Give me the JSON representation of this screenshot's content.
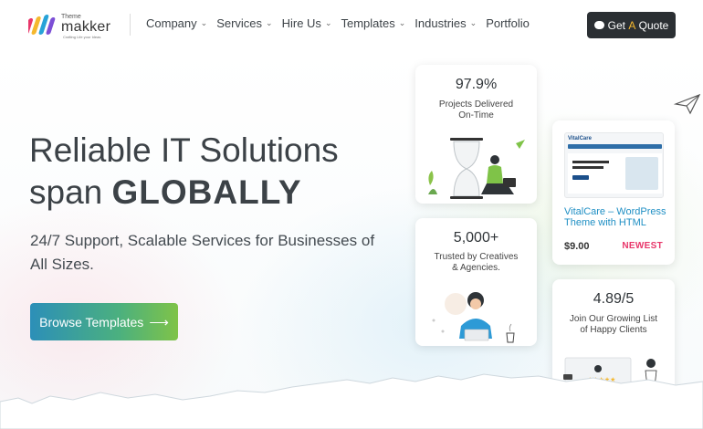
{
  "nav": {
    "logo_small": "Theme",
    "logo_brand": "makker",
    "logo_tagline": "Crafting Life your Ideas",
    "menu": [
      {
        "label": "Company",
        "dropdown": true
      },
      {
        "label": "Services",
        "dropdown": true
      },
      {
        "label": "Hire Us",
        "dropdown": true
      },
      {
        "label": "Templates",
        "dropdown": true
      },
      {
        "label": "Industries",
        "dropdown": true
      },
      {
        "label": "Portfolio",
        "dropdown": false
      }
    ],
    "cta_prefix": "Get ",
    "cta_accent": "A",
    "cta_suffix": " Quote",
    "cta_icon": "chat-icon"
  },
  "hero": {
    "title_line1": "Reliable IT Solutions",
    "title_line2_plain": "span ",
    "title_line2_bold": "GLOBALLY",
    "subtitle": "24/7 Support, Scalable Services for Businesses of All Sizes.",
    "button_label": "Browse Templates",
    "button_icon": "arrow-right-icon"
  },
  "cards": {
    "projects": {
      "value": "97.9%",
      "label": "Projects Delivered On-Time"
    },
    "clients": {
      "value": "5,000+",
      "label": "Trusted by Creatives & Agencies."
    },
    "template": {
      "brand": "VitalCare",
      "title": "VitalCare – WordPress Theme with HTML",
      "price": "$9.00",
      "badge": "NEWEST"
    },
    "rating": {
      "value": "4.89/5",
      "label": "Join Our Growing List of Happy Clients"
    }
  },
  "colors": {
    "dark": "#2b2f33",
    "accent_yellow": "#f5b82e",
    "link_blue": "#1f8fc4",
    "badge_pink": "#e8366a",
    "gradient_start": "#2c8fb8",
    "gradient_end": "#7fc348"
  }
}
